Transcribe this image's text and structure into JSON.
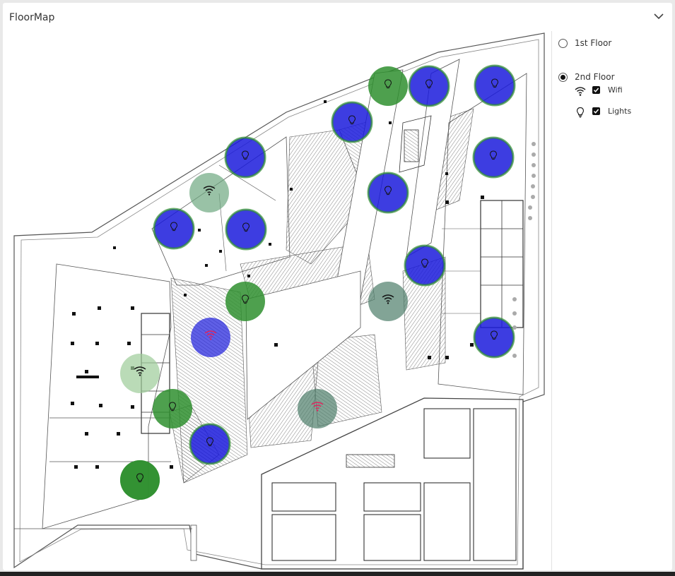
{
  "panel": {
    "title": "FloorMap"
  },
  "floors": [
    {
      "label": "1st Floor",
      "selected": false
    },
    {
      "label": "2nd Floor",
      "selected": true
    }
  ],
  "layers": [
    {
      "label": "Wifi",
      "icon": "wifi-icon",
      "checked": true
    },
    {
      "label": "Lights",
      "icon": "lightbulb-icon",
      "checked": true
    }
  ],
  "colors": {
    "on_blue": "#1b1bdc",
    "on_green": "#2f8f2f",
    "wifi_muted": "#6ea880",
    "wifi_gray": "#4d7d6a",
    "wifi_light": "#9ccc98",
    "alert_red": "#e0245e"
  },
  "markers": [
    {
      "type": "light",
      "state": "on-green"
    },
    {
      "type": "light",
      "state": "on-blue"
    },
    {
      "type": "light",
      "state": "on-blue"
    },
    {
      "type": "light",
      "state": "on-blue"
    },
    {
      "type": "light",
      "state": "on-blue"
    },
    {
      "type": "light",
      "state": "on-blue"
    },
    {
      "type": "light",
      "state": "on-blue"
    },
    {
      "type": "wifi",
      "state": "muted"
    },
    {
      "type": "light",
      "state": "on-blue"
    },
    {
      "type": "light",
      "state": "on-blue"
    },
    {
      "type": "light",
      "state": "on-blue"
    },
    {
      "type": "light",
      "state": "on-green"
    },
    {
      "type": "wifi",
      "state": "gray"
    },
    {
      "type": "wifi",
      "state": "alert"
    },
    {
      "type": "light",
      "state": "on-blue"
    },
    {
      "type": "wifi",
      "state": "light"
    },
    {
      "type": "light",
      "state": "on-green"
    },
    {
      "type": "wifi",
      "state": "alert-gray"
    },
    {
      "type": "light",
      "state": "on-blue"
    },
    {
      "type": "light",
      "state": "on-green"
    },
    {
      "type": "light",
      "state": "on-green"
    }
  ]
}
